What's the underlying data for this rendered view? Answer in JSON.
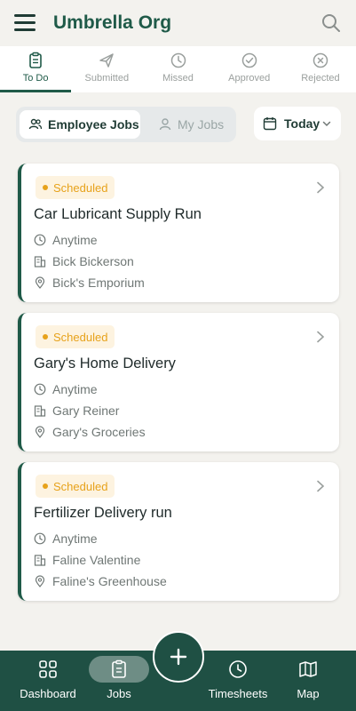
{
  "header": {
    "org_name": "Umbrella Org"
  },
  "tabs": [
    {
      "label": "To Do",
      "active": true
    },
    {
      "label": "Submitted"
    },
    {
      "label": "Missed"
    },
    {
      "label": "Approved"
    },
    {
      "label": "Rejected"
    }
  ],
  "filters": {
    "employee_jobs": "Employee Jobs",
    "my_jobs": "My Jobs",
    "date": "Today"
  },
  "jobs": [
    {
      "status": "Scheduled",
      "title": "Car Lubricant Supply Run",
      "time": "Anytime",
      "customer": "Bick Bickerson",
      "location": "Bick's Emporium"
    },
    {
      "status": "Scheduled",
      "title": "Gary's Home Delivery",
      "time": "Anytime",
      "customer": "Gary Reiner",
      "location": "Gary's Groceries"
    },
    {
      "status": "Scheduled",
      "title": "Fertilizer Delivery run",
      "time": "Anytime",
      "customer": "Faline Valentine",
      "location": "Faline's Greenhouse"
    }
  ],
  "bottom_nav": {
    "dashboard": "Dashboard",
    "jobs": "Jobs",
    "timesheets": "Timesheets",
    "map": "Map"
  },
  "colors": {
    "brand": "#1f5a48",
    "nav_bg": "#1f5044",
    "scheduled": "#e7a21b"
  }
}
